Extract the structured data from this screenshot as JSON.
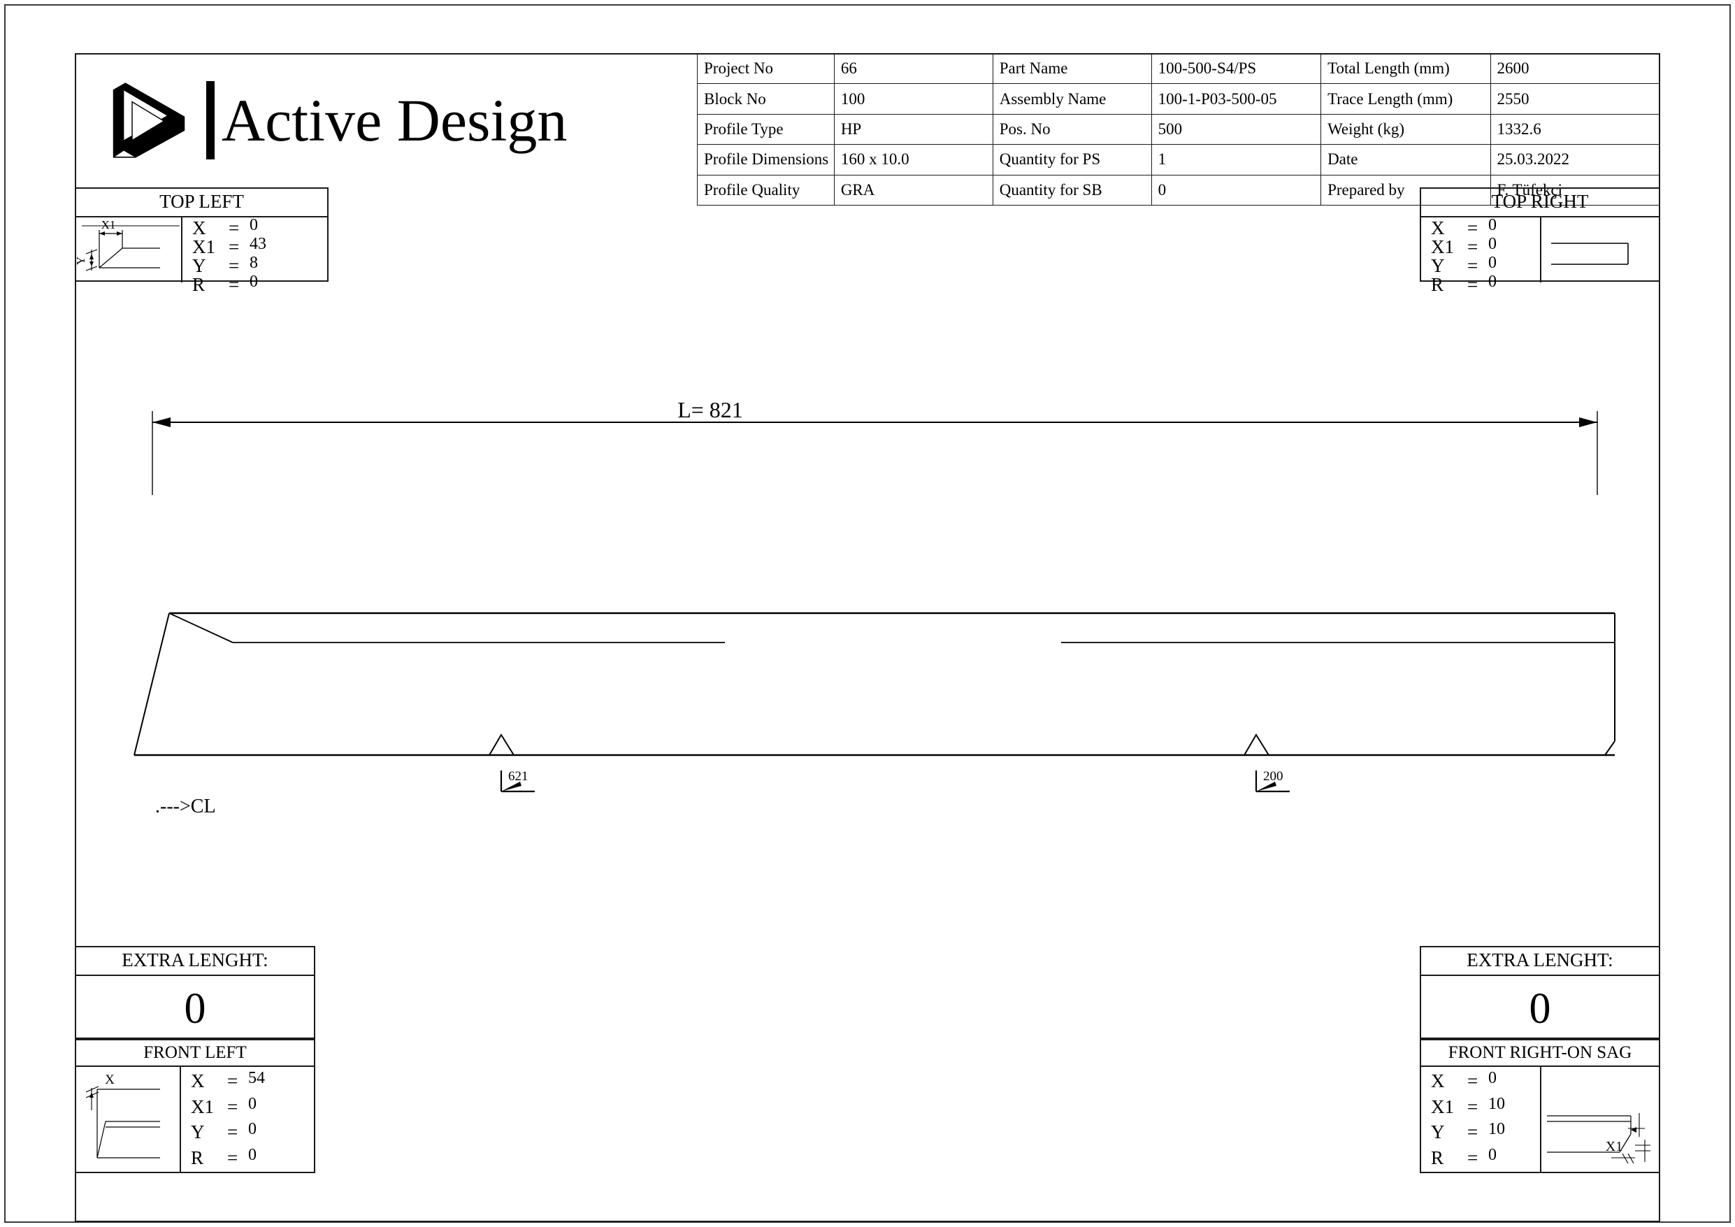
{
  "company": {
    "name": "Active Design",
    "logo_icon": "penrose-triangle-logo"
  },
  "title_block": {
    "rows": [
      {
        "label": "Project No",
        "value": "66",
        "label2": "Part Name",
        "value2": "100-500-S4/PS",
        "label3": "Total Length (mm)",
        "value3": "2600"
      },
      {
        "label": "Block No",
        "value": "100",
        "label2": "Assembly Name",
        "value2": "100-1-P03-500-05",
        "label3": "Trace Length (mm)",
        "value3": "2550"
      },
      {
        "label": "Profile Type",
        "value": "HP",
        "label2": "Pos. No",
        "value2": "500",
        "label3": "Weight (kg)",
        "value3": "1332.6"
      },
      {
        "label": "Profile Dimensions",
        "value": "160 x 10.0",
        "label2": "Quantity for PS",
        "value2": "1",
        "label3": "Date",
        "value3": "25.03.2022"
      },
      {
        "label": "Profile Quality",
        "value": "GRA",
        "label2": "Quantity for SB",
        "value2": "0",
        "label3": "Prepared by",
        "value3": "F. Tüfekçi"
      }
    ]
  },
  "top_left": {
    "title": "TOP LEFT",
    "fig_labels": {
      "x1": "X1",
      "y": "Y"
    },
    "keys": [
      "X",
      "X1",
      "Y",
      "R"
    ],
    "values": [
      "0",
      "43",
      "8",
      "0"
    ]
  },
  "top_right": {
    "title": "TOP RIGHT",
    "keys": [
      "X",
      "X1",
      "Y",
      "R"
    ],
    "values": [
      "0",
      "0",
      "0",
      "0"
    ]
  },
  "extra_left": {
    "title": "EXTRA LENGHT:",
    "value": "0"
  },
  "extra_right": {
    "title": "EXTRA LENGHT:",
    "value": "0"
  },
  "front_left": {
    "title": "FRONT LEFT",
    "fig_labels": {
      "x": "X"
    },
    "keys": [
      "X",
      "X1",
      "Y",
      "R"
    ],
    "values": [
      "54",
      "0",
      "0",
      "0"
    ]
  },
  "front_right": {
    "title": "FRONT RIGHT-ON SAG",
    "fig_labels": {
      "x1": "X1"
    },
    "keys": [
      "X",
      "X1",
      "Y",
      "R"
    ],
    "values": [
      "0",
      "10",
      "10",
      "0"
    ]
  },
  "main_view": {
    "length_dimension": "L= 821",
    "centerline_note": ".--->CL",
    "markers": [
      {
        "label": "621"
      },
      {
        "label": "200"
      }
    ]
  }
}
